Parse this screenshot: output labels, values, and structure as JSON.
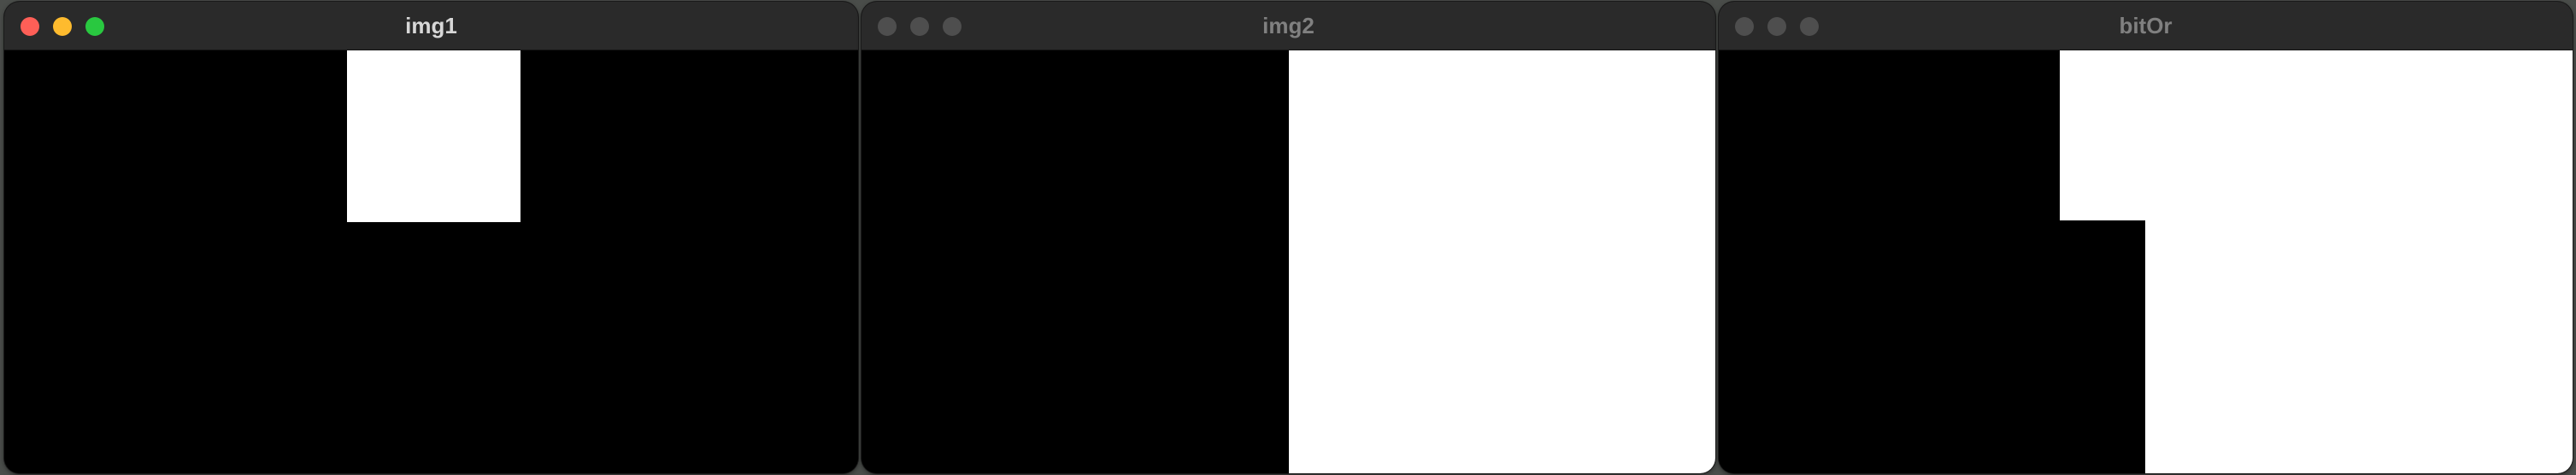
{
  "windows": [
    {
      "title": "img1",
      "active": true,
      "traffic_lights": [
        "#ff5f57",
        "#febc2e",
        "#28c840"
      ],
      "image": {
        "background": "#000000",
        "shape_color": "#ffffff"
      }
    },
    {
      "title": "img2",
      "active": false,
      "traffic_lights": [
        "#4e4e4e",
        "#4e4e4e",
        "#4e4e4e"
      ],
      "image": {
        "background": "#000000",
        "shape_color": "#ffffff"
      }
    },
    {
      "title": "bitOr",
      "active": false,
      "traffic_lights": [
        "#4e4e4e",
        "#4e4e4e",
        "#4e4e4e"
      ],
      "image": {
        "background": "#000000",
        "shape_color": "#ffffff"
      }
    }
  ]
}
